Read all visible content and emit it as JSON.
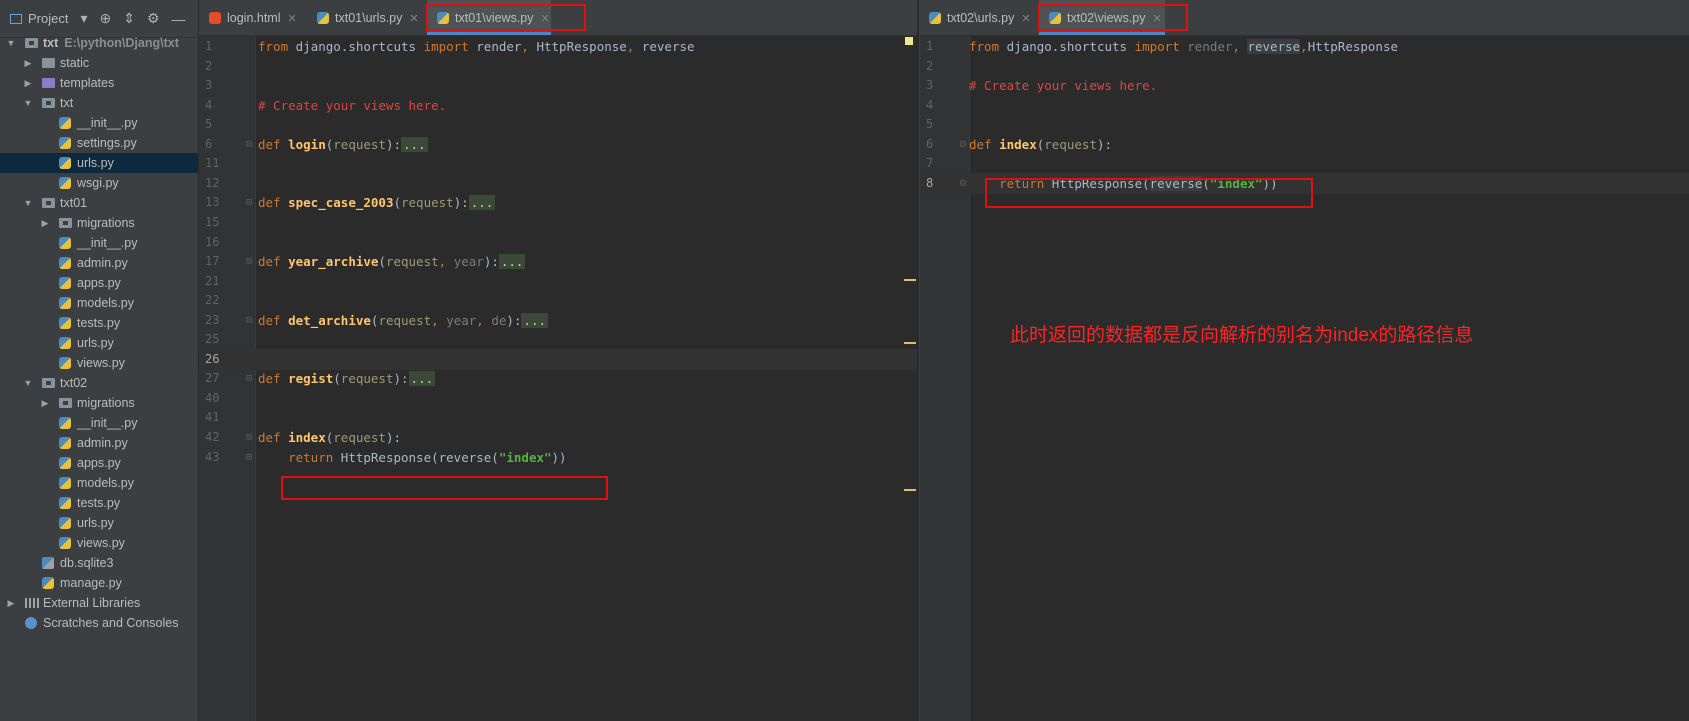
{
  "project_pane": {
    "title": "Project",
    "tree": [
      {
        "label": "txt",
        "path": "E:\\python\\Djang\\txt",
        "indent": 0,
        "arrow": "▼",
        "icon": "pkg",
        "bold": true
      },
      {
        "label": "static",
        "indent": 1,
        "arrow": "▶",
        "icon": "folder"
      },
      {
        "label": "templates",
        "indent": 1,
        "arrow": "▶",
        "icon": "folder-purple"
      },
      {
        "label": "txt",
        "indent": 1,
        "arrow": "▼",
        "icon": "pkg"
      },
      {
        "label": "__init__.py",
        "indent": 2,
        "icon": "py"
      },
      {
        "label": "settings.py",
        "indent": 2,
        "icon": "py"
      },
      {
        "label": "urls.py",
        "indent": 2,
        "icon": "py",
        "selected": true
      },
      {
        "label": "wsgi.py",
        "indent": 2,
        "icon": "py"
      },
      {
        "label": "txt01",
        "indent": 1,
        "arrow": "▼",
        "icon": "pkg"
      },
      {
        "label": "migrations",
        "indent": 2,
        "arrow": "▶",
        "icon": "pkg"
      },
      {
        "label": "__init__.py",
        "indent": 2,
        "icon": "py"
      },
      {
        "label": "admin.py",
        "indent": 2,
        "icon": "py"
      },
      {
        "label": "apps.py",
        "indent": 2,
        "icon": "py"
      },
      {
        "label": "models.py",
        "indent": 2,
        "icon": "py"
      },
      {
        "label": "tests.py",
        "indent": 2,
        "icon": "py"
      },
      {
        "label": "urls.py",
        "indent": 2,
        "icon": "py"
      },
      {
        "label": "views.py",
        "indent": 2,
        "icon": "py"
      },
      {
        "label": "txt02",
        "indent": 1,
        "arrow": "▼",
        "icon": "pkg"
      },
      {
        "label": "migrations",
        "indent": 2,
        "arrow": "▶",
        "icon": "pkg"
      },
      {
        "label": "__init__.py",
        "indent": 2,
        "icon": "py"
      },
      {
        "label": "admin.py",
        "indent": 2,
        "icon": "py"
      },
      {
        "label": "apps.py",
        "indent": 2,
        "icon": "py"
      },
      {
        "label": "models.py",
        "indent": 2,
        "icon": "py"
      },
      {
        "label": "tests.py",
        "indent": 2,
        "icon": "py"
      },
      {
        "label": "urls.py",
        "indent": 2,
        "icon": "py"
      },
      {
        "label": "views.py",
        "indent": 2,
        "icon": "py"
      },
      {
        "label": "db.sqlite3",
        "indent": 1,
        "icon": "db"
      },
      {
        "label": "manage.py",
        "indent": 1,
        "icon": "py"
      },
      {
        "label": "External Libraries",
        "indent": 0,
        "arrow": "▶",
        "icon": "lib"
      },
      {
        "label": "Scratches and Consoles",
        "indent": 0,
        "icon": "scratch"
      }
    ]
  },
  "left_tabs": [
    {
      "label": "login.html",
      "icon": "html-file-icon"
    },
    {
      "label": "txt01\\urls.py",
      "icon": "python-file-icon"
    },
    {
      "label": "txt01\\views.py",
      "icon": "python-file-icon",
      "active": true
    }
  ],
  "right_tabs": [
    {
      "label": "txt02\\urls.py",
      "icon": "python-file-icon"
    },
    {
      "label": "txt02\\views.py",
      "icon": "python-file-icon",
      "active": true
    }
  ],
  "left_editor": {
    "lines": [
      {
        "n": "1",
        "tokens": [
          [
            "kw",
            "from "
          ],
          [
            "par",
            "django.shortcuts "
          ],
          [
            "kw",
            "import "
          ],
          [
            "par",
            "render"
          ],
          [
            "kw",
            ", "
          ],
          [
            "par",
            "HttpResponse"
          ],
          [
            "kw",
            ", "
          ],
          [
            "par",
            "reverse"
          ]
        ]
      },
      {
        "n": "2",
        "tokens": []
      },
      {
        "n": "3",
        "tokens": []
      },
      {
        "n": "4",
        "tokens": [
          [
            "cmt",
            "# Create your views here."
          ]
        ]
      },
      {
        "n": "5",
        "tokens": []
      },
      {
        "n": "6",
        "fold": true,
        "tokens": [
          [
            "kw",
            "def "
          ],
          [
            "fn",
            "login"
          ],
          [
            "par",
            "("
          ],
          [
            "param",
            "request"
          ],
          [
            "par",
            "):"
          ],
          [
            "fold-dots",
            "..."
          ]
        ]
      },
      {
        "n": "11",
        "tokens": []
      },
      {
        "n": "12",
        "tokens": []
      },
      {
        "n": "13",
        "fold": true,
        "tokens": [
          [
            "kw",
            "def "
          ],
          [
            "fn",
            "spec_case_2003"
          ],
          [
            "par",
            "("
          ],
          [
            "param",
            "request"
          ],
          [
            "par",
            "):"
          ],
          [
            "fold-dots",
            "..."
          ]
        ]
      },
      {
        "n": "15",
        "tokens": []
      },
      {
        "n": "16",
        "tokens": []
      },
      {
        "n": "17",
        "fold": true,
        "tokens": [
          [
            "kw",
            "def "
          ],
          [
            "fn",
            "year_archive"
          ],
          [
            "par",
            "("
          ],
          [
            "param",
            "request"
          ],
          [
            "kw",
            ", "
          ],
          [
            "dim",
            "year"
          ],
          [
            "par",
            "):"
          ],
          [
            "fold-dots",
            "..."
          ]
        ]
      },
      {
        "n": "21",
        "tokens": []
      },
      {
        "n": "22",
        "tokens": []
      },
      {
        "n": "23",
        "fold": true,
        "tokens": [
          [
            "kw",
            "def "
          ],
          [
            "fn",
            "det_archive"
          ],
          [
            "par",
            "("
          ],
          [
            "param",
            "request"
          ],
          [
            "kw",
            ", "
          ],
          [
            "dim",
            "year"
          ],
          [
            "kw",
            ", "
          ],
          [
            "dim",
            "de"
          ],
          [
            "par",
            "):"
          ],
          [
            "fold-dots",
            "..."
          ]
        ]
      },
      {
        "n": "25",
        "tokens": []
      },
      {
        "n": "26",
        "current": true,
        "tokens": []
      },
      {
        "n": "27",
        "fold": true,
        "tokens": [
          [
            "kw",
            "def "
          ],
          [
            "fn",
            "regist"
          ],
          [
            "par",
            "("
          ],
          [
            "param",
            "request"
          ],
          [
            "par",
            "):"
          ],
          [
            "fold-dots",
            "..."
          ]
        ]
      },
      {
        "n": "40",
        "tokens": []
      },
      {
        "n": "41",
        "tokens": []
      },
      {
        "n": "42",
        "fold": true,
        "tokens": [
          [
            "kw",
            "def "
          ],
          [
            "fn",
            "index"
          ],
          [
            "par",
            "("
          ],
          [
            "param",
            "request"
          ],
          [
            "par",
            "):"
          ]
        ]
      },
      {
        "n": "43",
        "fold": true,
        "tokens": [
          [
            "par",
            "    "
          ],
          [
            "kw",
            "return "
          ],
          [
            "par",
            "HttpResponse(reverse("
          ],
          [
            "strh",
            "\"index\""
          ],
          [
            "par",
            "))"
          ]
        ]
      }
    ]
  },
  "right_editor": {
    "lines": [
      {
        "n": "1",
        "tokens": [
          [
            "kw",
            "from "
          ],
          [
            "par",
            "django.shortcuts "
          ],
          [
            "kw",
            "import "
          ],
          [
            "dim",
            "render"
          ],
          [
            "kw",
            ", "
          ],
          [
            "hl",
            "reverse"
          ],
          [
            "kw",
            ","
          ],
          [
            "par",
            "HttpResponse"
          ]
        ]
      },
      {
        "n": "2",
        "tokens": []
      },
      {
        "n": "3",
        "tokens": [
          [
            "cmt",
            "# Create your views here."
          ]
        ]
      },
      {
        "n": "4",
        "tokens": []
      },
      {
        "n": "5",
        "tokens": []
      },
      {
        "n": "6",
        "fold": true,
        "tokens": [
          [
            "kw",
            "def "
          ],
          [
            "fn",
            "index"
          ],
          [
            "par",
            "("
          ],
          [
            "param",
            "request"
          ],
          [
            "par",
            "):"
          ]
        ]
      },
      {
        "n": "7",
        "tokens": []
      },
      {
        "n": "8",
        "current": true,
        "fold": true,
        "tokens": [
          [
            "par",
            "    "
          ],
          [
            "kw",
            "return "
          ],
          [
            "par",
            "HttpResponse("
          ],
          [
            "hl",
            "reverse"
          ],
          [
            "par",
            "("
          ],
          [
            "strh",
            "\"index\""
          ],
          [
            "par",
            "))"
          ]
        ]
      }
    ]
  },
  "annotation": "此时返回的数据都是反向解析的别名为index的路径信息"
}
